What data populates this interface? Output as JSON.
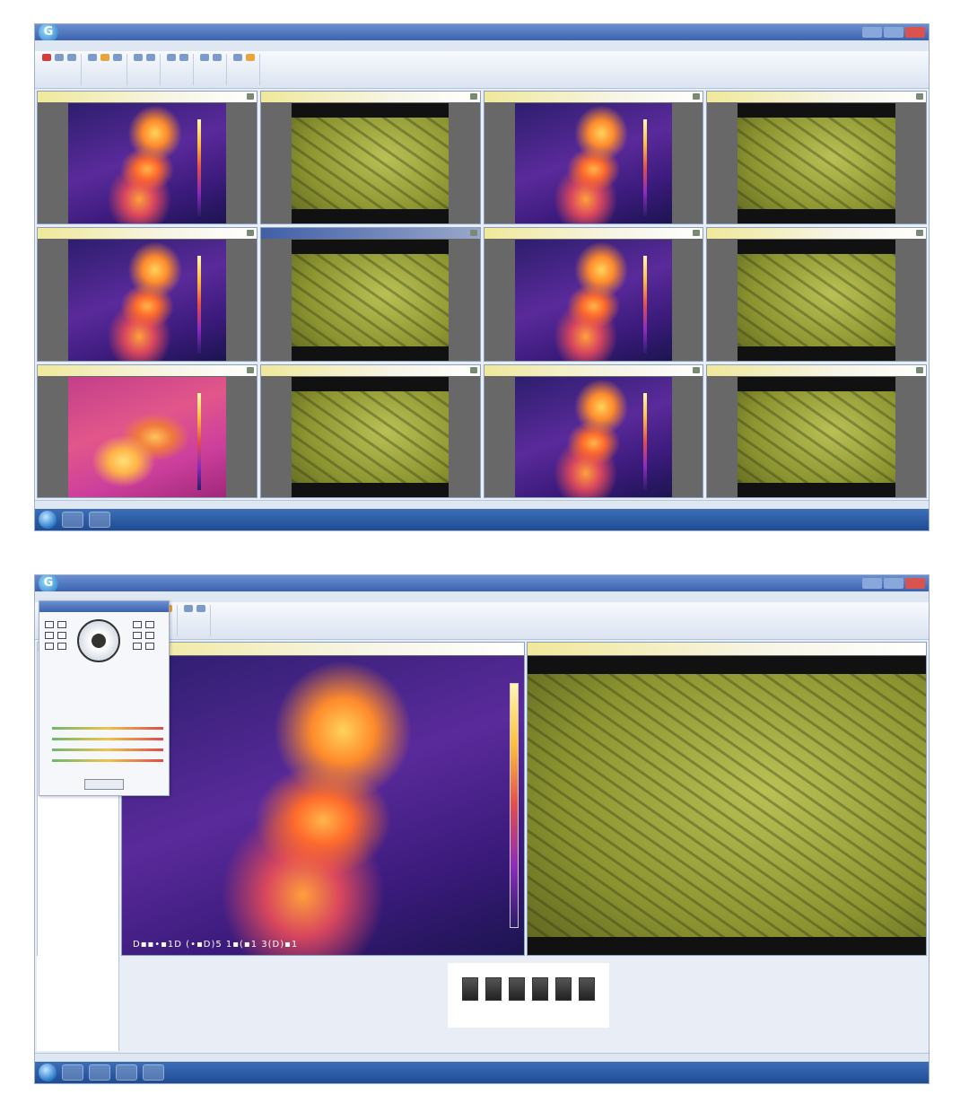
{
  "app_logo": "G",
  "shot1": {
    "cells": [
      {
        "kind": "thermal"
      },
      {
        "kind": "visible"
      },
      {
        "kind": "thermal"
      },
      {
        "kind": "visible"
      },
      {
        "kind": "thermal"
      },
      {
        "kind": "visible",
        "selected": true
      },
      {
        "kind": "thermal"
      },
      {
        "kind": "visible"
      },
      {
        "kind": "thermal",
        "variant": "warm"
      },
      {
        "kind": "visible"
      },
      {
        "kind": "thermal"
      },
      {
        "kind": "visible"
      }
    ]
  },
  "shot2": {
    "thermal_view": {
      "osd": "D▪▪•▪1D  (•▪D)5  1▪(▪1 3(D)▪1"
    }
  },
  "colors": {
    "title_bar": "#3c62b0",
    "taskbar": "#1f4c94",
    "cell_header_yellow": "#f0e89a",
    "visible_feed": "#8c9430",
    "thermal_hot": "#ffb54a",
    "thermal_cold": "#2d1e6e"
  },
  "icons": [
    "app-logo-icon",
    "camera-icon",
    "ptz-joystick-icon",
    "start-orb-icon",
    "taskbar-explorer-icon"
  ]
}
